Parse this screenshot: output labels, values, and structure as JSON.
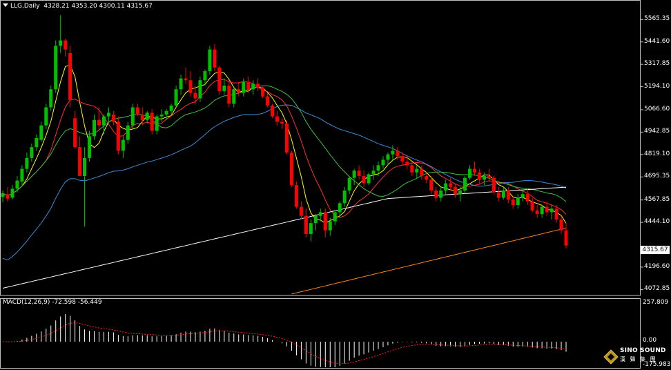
{
  "header": {
    "symbol": "LLG,Daily",
    "ohlc": "4328.21 4353.20 4300.11 4315.67"
  },
  "macd": {
    "label": "MACD(12,26,9) -72.598 -56.449",
    "scale_top": "257.809",
    "scale_zero": "0.00",
    "scale_bottom": "-175.983"
  },
  "price_axis": [
    "5565.35",
    "5441.60",
    "5317.85",
    "5194.10",
    "5066.60",
    "4942.85",
    "4819.10",
    "4695.35",
    "4567.85",
    "4444.10",
    "4196.60",
    "4072.85"
  ],
  "last_price": "4315.67",
  "logo": {
    "title": "SINO SOUND",
    "subtitle": "漢 聲 集 團"
  },
  "colors": {
    "bull": "#00c000",
    "bear": "#ff0000",
    "ma5": "#ffff00",
    "ma10": "#ff3030",
    "ma20": "#40c040",
    "ma60": "#3a8fd8",
    "ma120": "#ffffff",
    "ma250": "#ff8a20",
    "signal": "#ff2020"
  },
  "chart_data": {
    "type": "candlestick",
    "timeframe": "Daily",
    "ylim": [
      4040,
      5620
    ],
    "candles": [
      [
        4585,
        4620,
        4555,
        4605
      ],
      [
        4600,
        4640,
        4560,
        4575
      ],
      [
        4580,
        4650,
        4570,
        4630
      ],
      [
        4630,
        4700,
        4610,
        4675
      ],
      [
        4670,
        4760,
        4650,
        4740
      ],
      [
        4740,
        4830,
        4720,
        4800
      ],
      [
        4800,
        4880,
        4780,
        4860
      ],
      [
        4860,
        4930,
        4840,
        4910
      ],
      [
        4900,
        5000,
        4890,
        4980
      ],
      [
        4980,
        5100,
        4960,
        5080
      ],
      [
        5080,
        5200,
        5060,
        5180
      ],
      [
        5180,
        5450,
        5160,
        5420
      ],
      [
        5420,
        5590,
        5380,
        5450
      ],
      [
        5450,
        5460,
        5360,
        5400
      ],
      [
        5380,
        5420,
        5080,
        5120
      ],
      [
        5020,
        5060,
        4850,
        4860
      ],
      [
        4860,
        4920,
        4700,
        4700
      ],
      [
        4700,
        4860,
        4420,
        4800
      ],
      [
        4800,
        4950,
        4780,
        4920
      ],
      [
        4920,
        5040,
        4900,
        5010
      ],
      [
        5010,
        5080,
        4950,
        4980
      ],
      [
        4980,
        5040,
        4930,
        5030
      ],
      [
        5030,
        5080,
        5000,
        5050
      ],
      [
        5040,
        5060,
        4980,
        5000
      ],
      [
        5000,
        5030,
        4820,
        4840
      ],
      [
        4840,
        4920,
        4800,
        4900
      ],
      [
        4900,
        5000,
        4880,
        4980
      ],
      [
        4980,
        5100,
        4960,
        5080
      ],
      [
        5080,
        5100,
        5030,
        5040
      ],
      [
        5040,
        5080,
        4980,
        5010
      ],
      [
        5010,
        5060,
        4990,
        5050
      ],
      [
        5050,
        5070,
        4930,
        4950
      ],
      [
        4950,
        5040,
        4930,
        5030
      ],
      [
        5030,
        5070,
        5000,
        5040
      ],
      [
        5040,
        5070,
        5010,
        5060
      ],
      [
        5060,
        5100,
        5040,
        5090
      ],
      [
        5090,
        5200,
        5080,
        5180
      ],
      [
        5180,
        5260,
        5150,
        5240
      ],
      [
        5240,
        5300,
        5210,
        5230
      ],
      [
        5230,
        5280,
        5140,
        5160
      ],
      [
        5160,
        5200,
        5100,
        5130
      ],
      [
        5130,
        5250,
        5110,
        5230
      ],
      [
        5230,
        5290,
        5200,
        5280
      ],
      [
        5280,
        5420,
        5260,
        5400
      ],
      [
        5400,
        5430,
        5280,
        5300
      ],
      [
        5300,
        5310,
        5150,
        5170
      ],
      [
        5170,
        5240,
        5150,
        5200
      ],
      [
        5200,
        5230,
        5080,
        5100
      ],
      [
        5100,
        5190,
        5080,
        5180
      ],
      [
        5180,
        5220,
        5140,
        5160
      ],
      [
        5160,
        5240,
        5140,
        5220
      ],
      [
        5220,
        5250,
        5160,
        5180
      ],
      [
        5180,
        5230,
        5150,
        5210
      ],
      [
        5210,
        5240,
        5170,
        5190
      ],
      [
        5190,
        5200,
        5130,
        5140
      ],
      [
        5140,
        5160,
        5080,
        5090
      ],
      [
        5090,
        5100,
        5020,
        5030
      ],
      [
        5030,
        5060,
        4980,
        5000
      ],
      [
        5000,
        5020,
        4960,
        4990
      ],
      [
        4990,
        5010,
        4820,
        4830
      ],
      [
        4830,
        4840,
        4640,
        4650
      ],
      [
        4650,
        4670,
        4520,
        4530
      ],
      [
        4530,
        4560,
        4460,
        4480
      ],
      [
        4480,
        4520,
        4360,
        4380
      ],
      [
        4380,
        4460,
        4340,
        4440
      ],
      [
        4440,
        4490,
        4400,
        4480
      ],
      [
        4480,
        4520,
        4450,
        4500
      ],
      [
        4500,
        4520,
        4360,
        4400
      ],
      [
        4400,
        4470,
        4370,
        4450
      ],
      [
        4450,
        4510,
        4430,
        4500
      ],
      [
        4500,
        4560,
        4470,
        4550
      ],
      [
        4550,
        4640,
        4530,
        4620
      ],
      [
        4620,
        4700,
        4600,
        4690
      ],
      [
        4690,
        4740,
        4650,
        4730
      ],
      [
        4730,
        4760,
        4680,
        4700
      ],
      [
        4700,
        4730,
        4640,
        4660
      ],
      [
        4660,
        4720,
        4650,
        4710
      ],
      [
        4710,
        4760,
        4680,
        4730
      ],
      [
        4730,
        4780,
        4700,
        4760
      ],
      [
        4760,
        4810,
        4740,
        4790
      ],
      [
        4790,
        4830,
        4760,
        4820
      ],
      [
        4820,
        4870,
        4780,
        4840
      ],
      [
        4840,
        4860,
        4790,
        4810
      ],
      [
        4810,
        4830,
        4760,
        4780
      ],
      [
        4780,
        4820,
        4740,
        4760
      ],
      [
        4760,
        4780,
        4700,
        4720
      ],
      [
        4720,
        4760,
        4690,
        4740
      ],
      [
        4740,
        4760,
        4680,
        4700
      ],
      [
        4700,
        4720,
        4660,
        4680
      ],
      [
        4680,
        4700,
        4600,
        4620
      ],
      [
        4620,
        4640,
        4560,
        4580
      ],
      [
        4580,
        4640,
        4560,
        4620
      ],
      [
        4620,
        4680,
        4600,
        4660
      ],
      [
        4660,
        4690,
        4620,
        4640
      ],
      [
        4640,
        4660,
        4580,
        4600
      ],
      [
        4600,
        4640,
        4560,
        4620
      ],
      [
        4620,
        4700,
        4600,
        4690
      ],
      [
        4690,
        4760,
        4680,
        4740
      ],
      [
        4740,
        4780,
        4700,
        4720
      ],
      [
        4720,
        4740,
        4660,
        4680
      ],
      [
        4680,
        4720,
        4650,
        4700
      ],
      [
        4700,
        4740,
        4670,
        4690
      ],
      [
        4690,
        4700,
        4600,
        4610
      ],
      [
        4610,
        4640,
        4560,
        4580
      ],
      [
        4580,
        4640,
        4570,
        4620
      ],
      [
        4620,
        4640,
        4550,
        4570
      ],
      [
        4570,
        4590,
        4520,
        4540
      ],
      [
        4540,
        4600,
        4520,
        4580
      ],
      [
        4580,
        4620,
        4560,
        4600
      ],
      [
        4600,
        4630,
        4540,
        4560
      ],
      [
        4560,
        4580,
        4500,
        4510
      ],
      [
        4510,
        4540,
        4470,
        4490
      ],
      [
        4490,
        4540,
        4470,
        4530
      ],
      [
        4530,
        4560,
        4480,
        4500
      ],
      [
        4500,
        4540,
        4460,
        4520
      ],
      [
        4520,
        4540,
        4440,
        4460
      ],
      [
        4460,
        4480,
        4380,
        4400
      ],
      [
        4400,
        4440,
        4300,
        4316
      ]
    ],
    "macd_hist_range": [
      -175.983,
      257.809
    ]
  }
}
